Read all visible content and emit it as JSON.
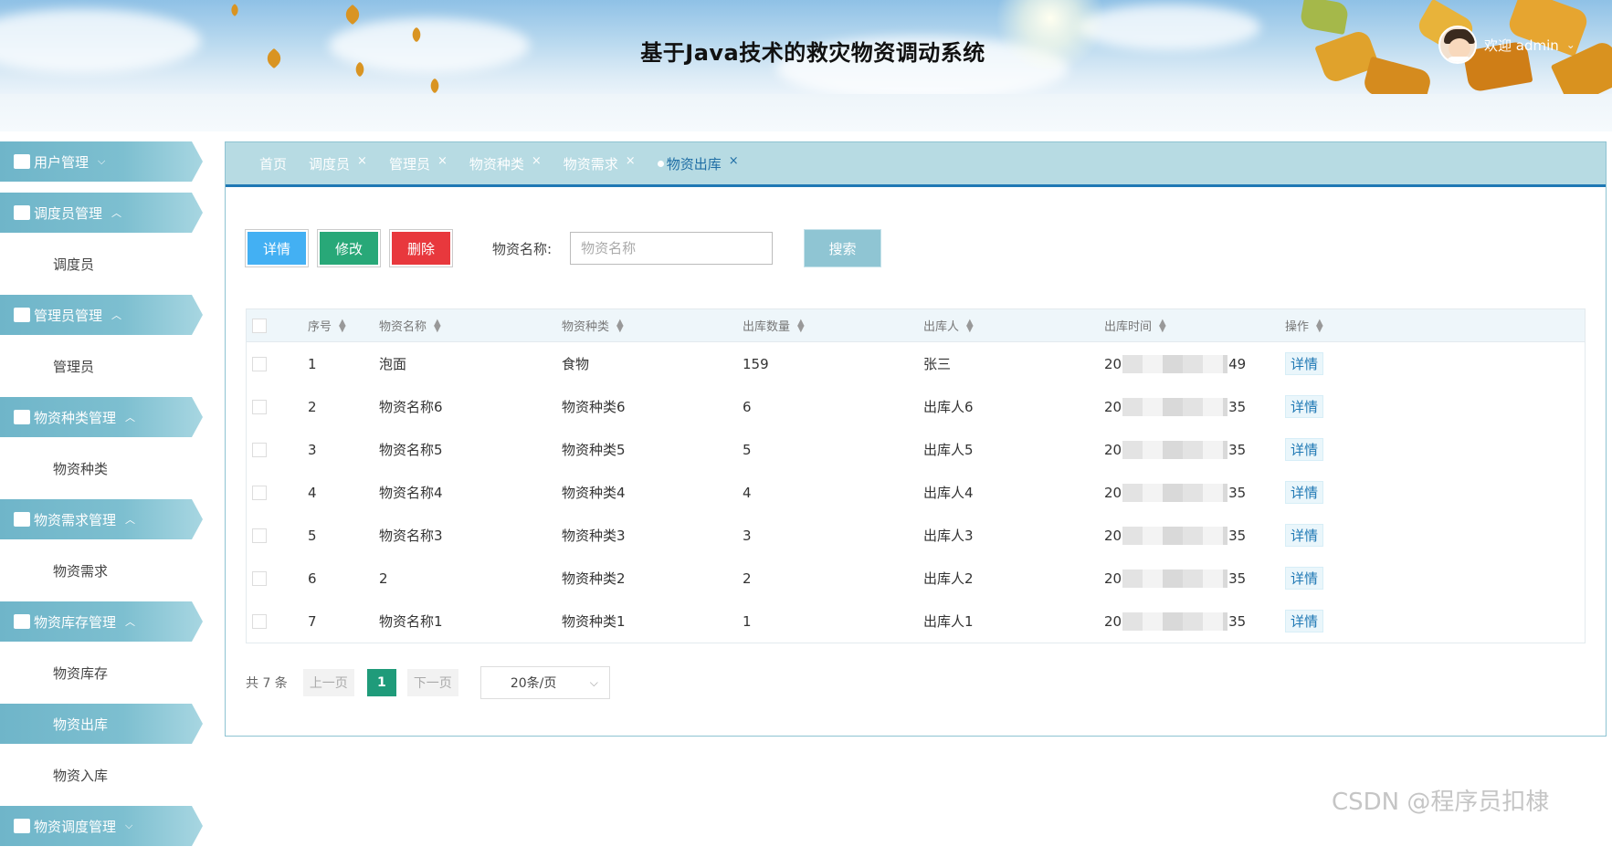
{
  "header": {
    "title": "基于Java技术的救灾物资调动系统",
    "welcome": "欢迎 admin",
    "user_caret": "⌄"
  },
  "sidebar": {
    "items": [
      {
        "type": "group",
        "label": "用户管理",
        "caret": "⌵",
        "icon": "user-icon"
      },
      {
        "type": "group",
        "label": "调度员管理",
        "caret": "︿",
        "icon": "briefcase-icon"
      },
      {
        "type": "sub",
        "label": "调度员"
      },
      {
        "type": "group",
        "label": "管理员管理",
        "caret": "︿",
        "icon": "card-icon"
      },
      {
        "type": "sub",
        "label": "管理员"
      },
      {
        "type": "group",
        "label": "物资种类管理",
        "caret": "︿",
        "icon": "copy-icon"
      },
      {
        "type": "sub",
        "label": "物资种类"
      },
      {
        "type": "group",
        "label": "物资需求管理",
        "caret": "︿",
        "icon": "briefcase-icon"
      },
      {
        "type": "sub",
        "label": "物资需求"
      },
      {
        "type": "group",
        "label": "物资库存管理",
        "caret": "︿",
        "icon": "wallet-icon"
      },
      {
        "type": "sub",
        "label": "物资库存"
      },
      {
        "type": "sub",
        "label": "物资出库",
        "active": true
      },
      {
        "type": "sub",
        "label": "物资入库"
      },
      {
        "type": "group",
        "label": "物资调度管理",
        "caret": "⌵",
        "icon": "person-icon"
      }
    ]
  },
  "tabs": [
    {
      "label": "首页",
      "closable": false
    },
    {
      "label": "调度员",
      "closable": true
    },
    {
      "label": "管理员",
      "closable": true
    },
    {
      "label": "物资种类",
      "closable": true
    },
    {
      "label": "物资需求",
      "closable": true
    },
    {
      "label": "物资出库",
      "closable": true,
      "active": true
    }
  ],
  "tab_close": "×",
  "toolbar": {
    "detail": "详情",
    "edit": "修改",
    "delete": "删除",
    "search_label": "物资名称:",
    "search_placeholder": "物资名称",
    "search_button": "搜索"
  },
  "table": {
    "columns": [
      "序号",
      "物资名称",
      "物资种类",
      "出库数量",
      "出库人",
      "出库时间",
      "操作"
    ],
    "rows": [
      {
        "no": "1",
        "name": "泡面",
        "category": "食物",
        "qty": "159",
        "person": "张三",
        "time_start": "20",
        "time_end": "49",
        "action": "详情"
      },
      {
        "no": "2",
        "name": "物资名称6",
        "category": "物资种类6",
        "qty": "6",
        "person": "出库人6",
        "time_start": "20",
        "time_end": "35",
        "action": "详情"
      },
      {
        "no": "3",
        "name": "物资名称5",
        "category": "物资种类5",
        "qty": "5",
        "person": "出库人5",
        "time_start": "20",
        "time_end": "35",
        "action": "详情"
      },
      {
        "no": "4",
        "name": "物资名称4",
        "category": "物资种类4",
        "qty": "4",
        "person": "出库人4",
        "time_start": "20",
        "time_end": "35",
        "action": "详情"
      },
      {
        "no": "5",
        "name": "物资名称3",
        "category": "物资种类3",
        "qty": "3",
        "person": "出库人3",
        "time_start": "20",
        "time_end": "35",
        "action": "详情"
      },
      {
        "no": "6",
        "name": "2",
        "category": "物资种类2",
        "qty": "2",
        "person": "出库人2",
        "time_start": "20",
        "time_end": "35",
        "action": "详情"
      },
      {
        "no": "7",
        "name": "物资名称1",
        "category": "物资种类1",
        "qty": "1",
        "person": "出库人1",
        "time_start": "20",
        "time_end": "35",
        "action": "详情"
      }
    ]
  },
  "pager": {
    "total": "共 7 条",
    "prev": "上一页",
    "current": "1",
    "next": "下一页",
    "page_size": "20条/页",
    "page_size_caret": "⌵"
  },
  "watermark": "CSDN @程序员扣棣",
  "colors": {
    "accent": "#1f78b4",
    "menu": "#7dbfd0",
    "detail_button": "#43b0f3",
    "edit_button": "#28a878",
    "delete_button": "#e8383d",
    "current_page": "#1f9b7a"
  }
}
